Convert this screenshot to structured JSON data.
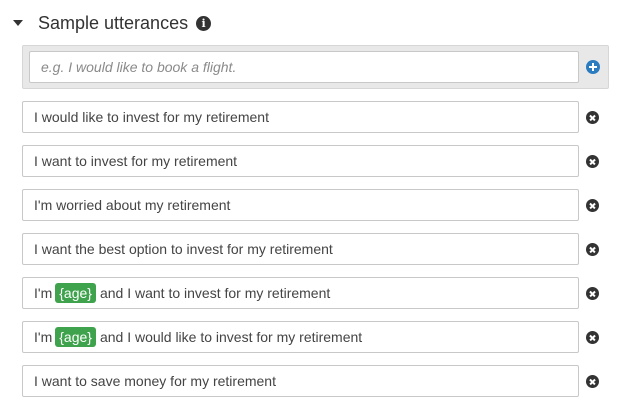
{
  "section": {
    "title": "Sample utterances",
    "info_icon": "info-circle-icon"
  },
  "new_utterance": {
    "placeholder": "e.g. I would like to book a flight.",
    "add_icon": "plus-circle-icon"
  },
  "utterances": [
    {
      "parts": [
        "I would like to invest for my retirement"
      ]
    },
    {
      "parts": [
        "I want to invest for my retirement"
      ]
    },
    {
      "parts": [
        "I'm worried about my retirement"
      ]
    },
    {
      "parts": [
        "I want the best option to invest for my retirement"
      ]
    },
    {
      "before": "I'm",
      "slot": "{age}",
      "after": "and I want to invest for my retirement"
    },
    {
      "before": "I'm",
      "slot": "{age}",
      "after": "and I would like to invest for my retirement"
    },
    {
      "parts": [
        "I want to save money for my retirement"
      ]
    }
  ],
  "colors": {
    "slot_background": "#3fa34d",
    "add_icon": "#2b7bc0",
    "remove_icon": "#333333"
  }
}
